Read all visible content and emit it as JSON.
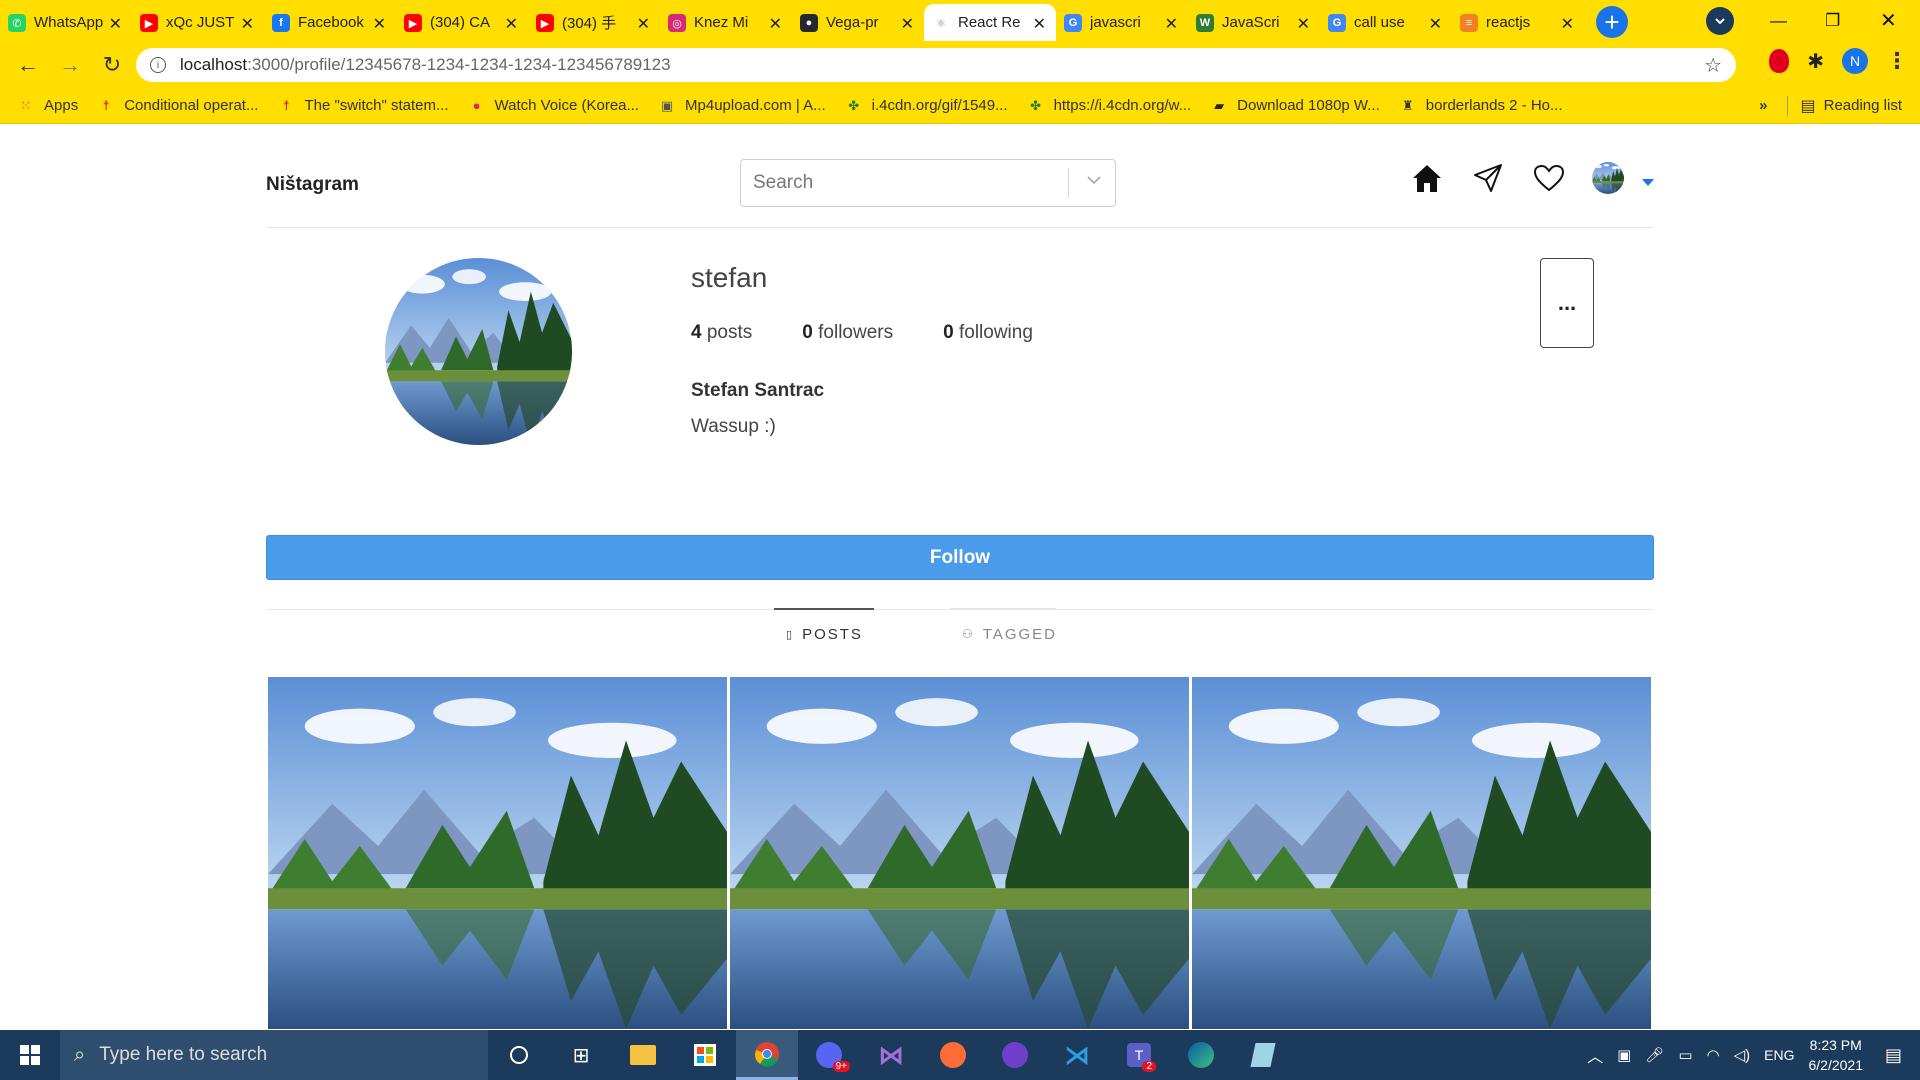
{
  "browser": {
    "tabs": [
      {
        "title": "WhatsApp",
        "color": "#25d366",
        "glyph": "✆"
      },
      {
        "title": "xQc JUST",
        "color": "#ff0000",
        "glyph": "▶"
      },
      {
        "title": "Facebook",
        "color": "#1877f2",
        "glyph": "f"
      },
      {
        "title": "(304) CA",
        "color": "#ff0000",
        "glyph": "▶"
      },
      {
        "title": "(304) 手",
        "color": "#ff0000",
        "glyph": "▶"
      },
      {
        "title": "Knez Mi",
        "color": "#d62976",
        "glyph": "◎"
      },
      {
        "title": "Vega-pr",
        "color": "#24292e",
        "glyph": "●"
      },
      {
        "title": "React Re",
        "color": "#ffffff",
        "glyph": "⚛"
      },
      {
        "title": "javascri",
        "color": "#4285f4",
        "glyph": "G"
      },
      {
        "title": "JavaScri",
        "color": "#2e7d32",
        "glyph": "W"
      },
      {
        "title": "call use",
        "color": "#4285f4",
        "glyph": "G"
      },
      {
        "title": "reactjs",
        "color": "#f48024",
        "glyph": "≡"
      }
    ],
    "active_tab_index": 7,
    "url_host": "localhost",
    "url_path": ":3000/profile/12345678-1234-1234-1234-123456789123",
    "profile_initial": "N",
    "bookmarks": [
      {
        "label": "Apps",
        "icon": "apps-icon"
      },
      {
        "label": "Conditional operat...",
        "icon": "person-red-icon"
      },
      {
        "label": "The \"switch\" statem...",
        "icon": "person-red-icon"
      },
      {
        "label": "Watch Voice (Korea...",
        "icon": "pink-circle-icon"
      },
      {
        "label": "Mp4upload.com | A...",
        "icon": "page-icon"
      },
      {
        "label": "i.4cdn.org/gif/1549...",
        "icon": "clover-icon"
      },
      {
        "label": "https://i.4cdn.org/w...",
        "icon": "clover-icon"
      },
      {
        "label": "Download 1080p W...",
        "icon": "download-icon"
      },
      {
        "label": "borderlands 2 - Ho...",
        "icon": "castle-icon"
      }
    ],
    "more_bookmarks": "»",
    "reading_list": "Reading list"
  },
  "app": {
    "brand": "Ništagram",
    "search_placeholder": "Search"
  },
  "profile": {
    "username": "stefan",
    "posts_count": "4",
    "posts_label": "posts",
    "followers_count": "0",
    "followers_label": "followers",
    "following_count": "0",
    "following_label": "following",
    "full_name": "Stefan Santrac",
    "bio": "Wassup :)",
    "more_label": "...",
    "follow_label": "Follow",
    "tab_posts": "POSTS",
    "tab_tagged": "TAGGED",
    "grid_count": 3
  },
  "taskbar": {
    "search_placeholder": "Type here to search",
    "language": "ENG",
    "time": "8:23 PM",
    "date": "6/2/2021",
    "teams_badge": "2",
    "discord_badge": "9+"
  },
  "colors": {
    "chrome_yellow": "#ffde00",
    "follow_blue": "#4a9bea",
    "taskbar": "#1b3a5c"
  }
}
